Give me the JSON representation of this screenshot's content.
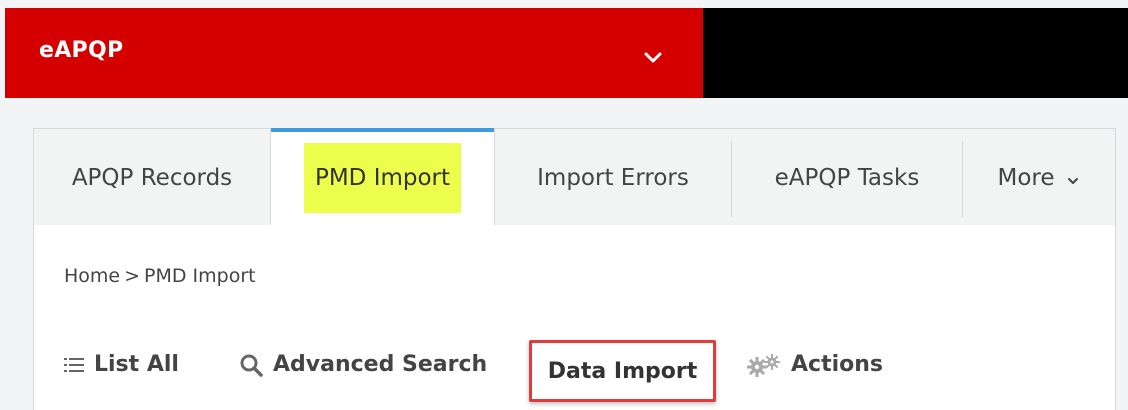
{
  "app": {
    "name": "eAPQP"
  },
  "tabs": [
    {
      "label": "APQP Records"
    },
    {
      "label": "PMD Import"
    },
    {
      "label": "Import Errors"
    },
    {
      "label": "eAPQP Tasks"
    },
    {
      "label": "More"
    }
  ],
  "breadcrumb": {
    "home": "Home",
    "separator": ">",
    "current": "PMD Import"
  },
  "actions": {
    "list_all": "List All",
    "advanced_search": "Advanced Search",
    "data_import": "Data Import",
    "actions": "Actions"
  },
  "colors": {
    "brand_red": "#d40000",
    "active_tab_accent": "#3d9be0",
    "highlight_yellow": "#ecfd4c",
    "annotation_red": "#e23b3b"
  },
  "icons": {
    "app_chevron": "chevron-down-icon",
    "more_chevron": "chevron-down-icon",
    "list_all": "list-icon",
    "advanced_search": "search-icon",
    "actions": "gears-icon"
  }
}
